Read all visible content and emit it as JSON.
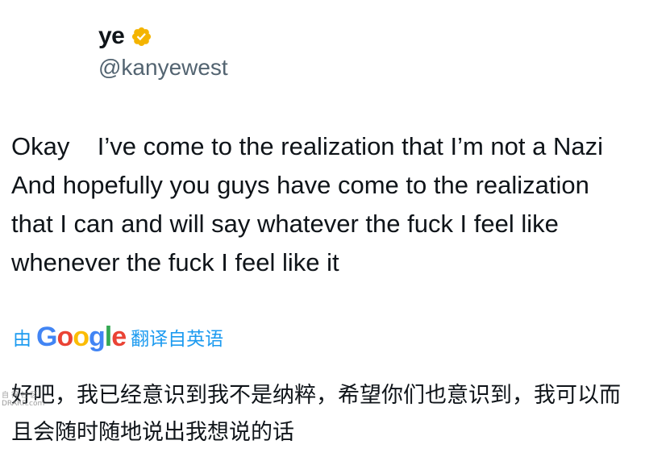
{
  "user": {
    "display_name": "ye",
    "handle": "@kanyewest",
    "verified": true,
    "verified_icon": "verified-badge-icon",
    "verified_color": "#f4b400"
  },
  "tweet": {
    "text": "Okay    I’ve come to the realization that I’m not a Nazi     And hopefully you guys have come to the realization that I can and will say whatever the fuck I feel like whenever the fuck I feel like it"
  },
  "translation": {
    "prefix": "由",
    "provider": "Google",
    "suffix": "翻译自英语",
    "text": "好吧，我已经意识到我不是纳粹，希望你们也意识到，我可以而且会随时随地说出我想说的话",
    "link_color": "#1d9bf0"
  },
  "watermark": {
    "line1": "自 得 社 区",
    "line2": "DRARR.com"
  }
}
